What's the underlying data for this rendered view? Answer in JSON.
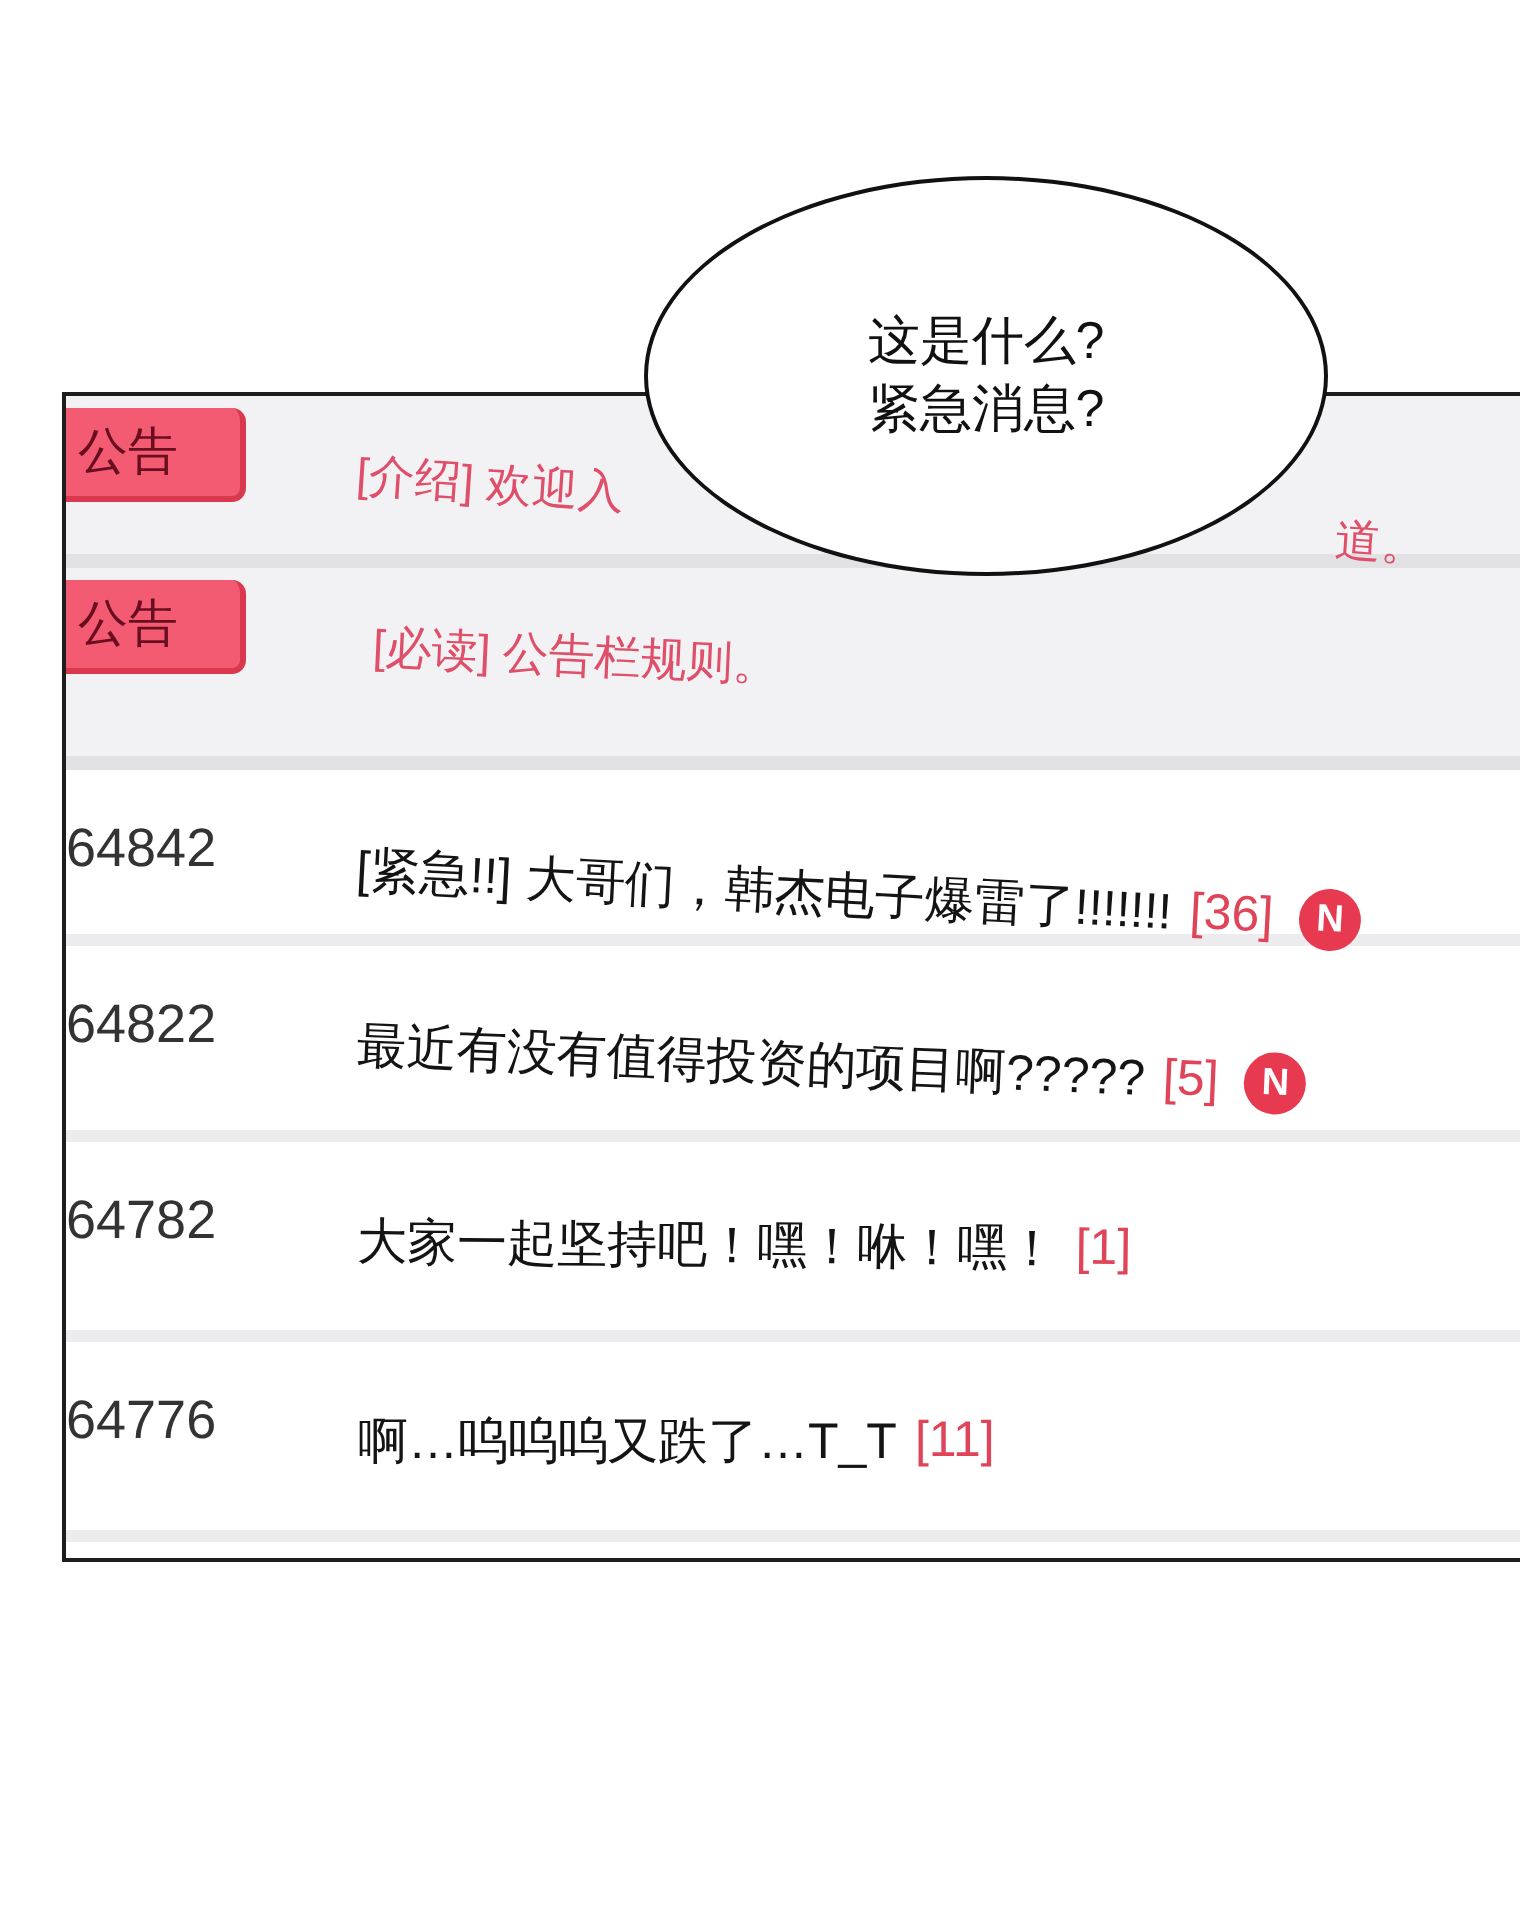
{
  "speech_bubble": {
    "lines": [
      "这是什么?",
      "紧急消息?"
    ]
  },
  "notices": [
    {
      "tag": "公告",
      "title_parts": [
        "[介绍] 欢迎入",
        "道。"
      ]
    },
    {
      "tag": "公告",
      "title_parts": [
        "[必读] 公告栏规则。"
      ]
    }
  ],
  "posts": [
    {
      "number": "64842",
      "title": "[紧急!!] 大哥们，韩杰电子爆雷了!!!!!!!",
      "comment_count": "[36]",
      "new_badge": "N"
    },
    {
      "number": "64822",
      "title": "最近有没有值得投资的项目啊?????",
      "comment_count": "[5]",
      "new_badge": "N"
    },
    {
      "number": "64782",
      "title": "大家一起坚持吧！嘿！咻！嘿！",
      "comment_count": "[1]"
    },
    {
      "number": "64776",
      "title": "啊…呜呜呜又跌了…T_T",
      "comment_count": "[11]"
    }
  ]
}
